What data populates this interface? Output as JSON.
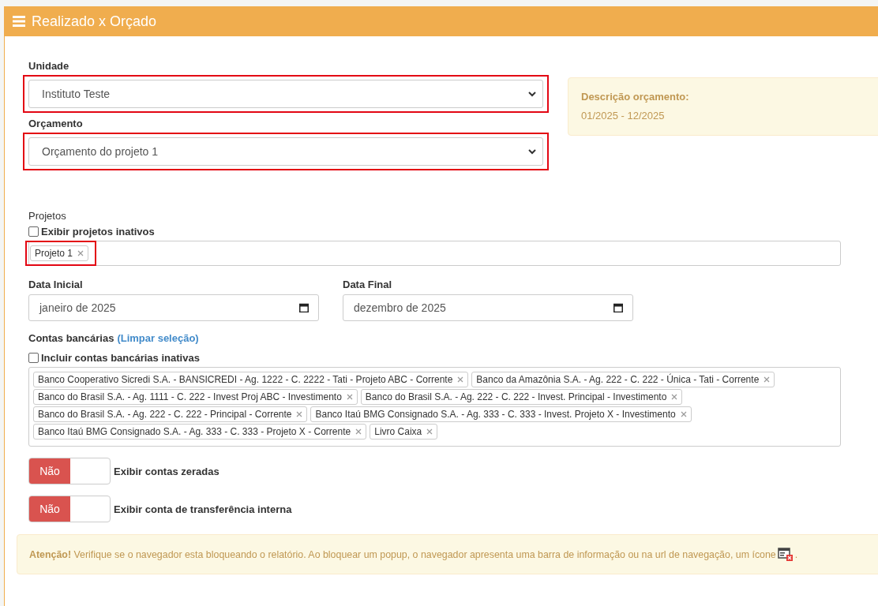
{
  "panel": {
    "title": "Realizado x Orçado"
  },
  "unidade": {
    "label": "Unidade",
    "value": "Instituto Teste",
    "highlighted": true
  },
  "orcamento": {
    "label": "Orçamento",
    "value": "Orçamento do projeto 1",
    "highlighted": true
  },
  "descricao": {
    "title": "Descrição orçamento:",
    "text": "01/2025 - 12/2025"
  },
  "projetos": {
    "label": "Projetos",
    "inactive_checkbox": {
      "label": "Exibir projetos inativos",
      "checked": false
    },
    "highlighted": true,
    "tags": [
      "Projeto 1"
    ]
  },
  "data_inicial": {
    "label": "Data Inicial",
    "value": "janeiro de 2025"
  },
  "data_final": {
    "label": "Data Final",
    "value": "dezembro de 2025"
  },
  "contas": {
    "label": "Contas bancárias",
    "clear_link": "(Limpar seleção)",
    "inactive_checkbox": {
      "label": "Incluir contas bancárias inativas",
      "checked": false
    },
    "tags": [
      "Banco Cooperativo Sicredi S.A. - BANSICREDI - Ag. 1222 - C. 2222 - Tati - Projeto ABC - Corrente",
      "Banco da Amazônia S.A. - Ag. 222 - C. 222 - Única - Tati - Corrente",
      "Banco do Brasil S.A. - Ag. 1111 - C. 222 - Invest Proj ABC - Investimento",
      "Banco do Brasil S.A. - Ag. 222 - C. 222 - Invest. Principal - Investimento",
      "Banco do Brasil S.A. - Ag. 222 - C. 222 - Principal - Corrente",
      "Banco Itaú BMG Consignado S.A. - Ag. 333 - C. 333 - Invest. Projeto X - Investimento",
      "Banco Itaú BMG Consignado S.A. - Ag. 333 - C. 333 - Projeto X - Corrente",
      "Livro Caixa"
    ]
  },
  "toggles": [
    {
      "state_label": "Não",
      "on": false,
      "label": "Exibir contas zeradas"
    },
    {
      "state_label": "Não",
      "on": false,
      "label": "Exibir conta de transferência interna"
    }
  ],
  "alert": {
    "text": "**Atenção!** Verifique se o navegador esta bloqueando o relatório. Ao bloquear um popup, o navegador apresenta uma barra de informação ou na url de navegação, um ícone",
    "end": "."
  }
}
